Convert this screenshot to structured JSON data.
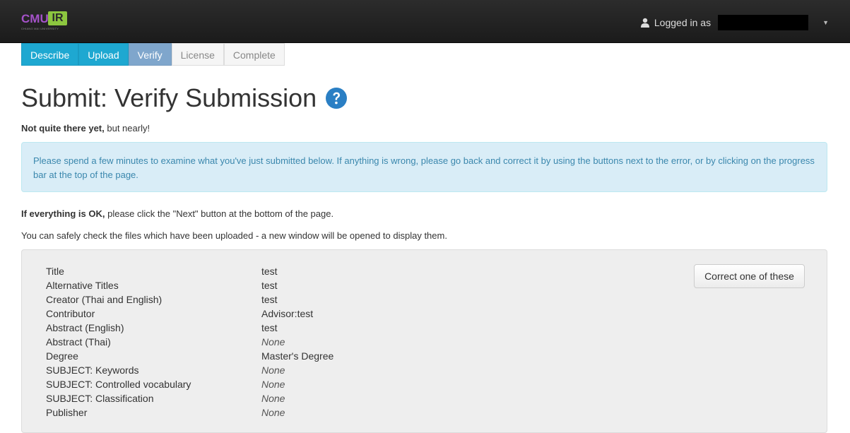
{
  "header": {
    "logo_text": "CMU",
    "logo_ir": "IR",
    "logo_tagline": "CHIANG MAI UNIVERSITY",
    "logged_in_label": "Logged in as"
  },
  "progress": [
    {
      "label": "Describe",
      "state": "done"
    },
    {
      "label": "Upload",
      "state": "done"
    },
    {
      "label": "Verify",
      "state": "current"
    },
    {
      "label": "License",
      "state": "todo"
    },
    {
      "label": "Complete",
      "state": "todo"
    }
  ],
  "page": {
    "title": "Submit: Verify Submission",
    "lead_bold": "Not quite there yet,",
    "lead_rest": " but nearly!",
    "info": "Please spend a few minutes to examine what you've just submitted below. If anything is wrong, please go back and correct it by using the buttons next to the error, or by clicking on the progress bar at the top of the page.",
    "ok_bold": "If everything is OK,",
    "ok_rest": " please click the \"Next\" button at the bottom of the page.",
    "files_note": "You can safely check the files which have been uploaded - a new window will be opened to display them."
  },
  "metadata": [
    {
      "label": "Title",
      "value": "test",
      "none": false
    },
    {
      "label": "Alternative Titles",
      "value": "test",
      "none": false
    },
    {
      "label": "Creator (Thai and English)",
      "value": "test",
      "none": false
    },
    {
      "label": "Contributor",
      "value": "Advisor:test",
      "none": false
    },
    {
      "label": "Abstract (English)",
      "value": "test",
      "none": false
    },
    {
      "label": "Abstract (Thai)",
      "value": "None",
      "none": true
    },
    {
      "label": "Degree",
      "value": "Master's Degree",
      "none": false
    },
    {
      "label": "SUBJECT: Keywords",
      "value": "None",
      "none": true
    },
    {
      "label": "SUBJECT: Controlled vocabulary",
      "value": "None",
      "none": true
    },
    {
      "label": "SUBJECT: Classification",
      "value": "None",
      "none": true
    },
    {
      "label": "Publisher",
      "value": "None",
      "none": true
    }
  ],
  "correct_button": "Correct one of these",
  "colors": {
    "navbar": "#1b1b1b",
    "step_done": "#1ea8d1",
    "step_current": "#7fa6cc",
    "info_bg": "#d9edf7",
    "info_text": "#3a87ad",
    "help_icon": "#2a7fc4"
  }
}
